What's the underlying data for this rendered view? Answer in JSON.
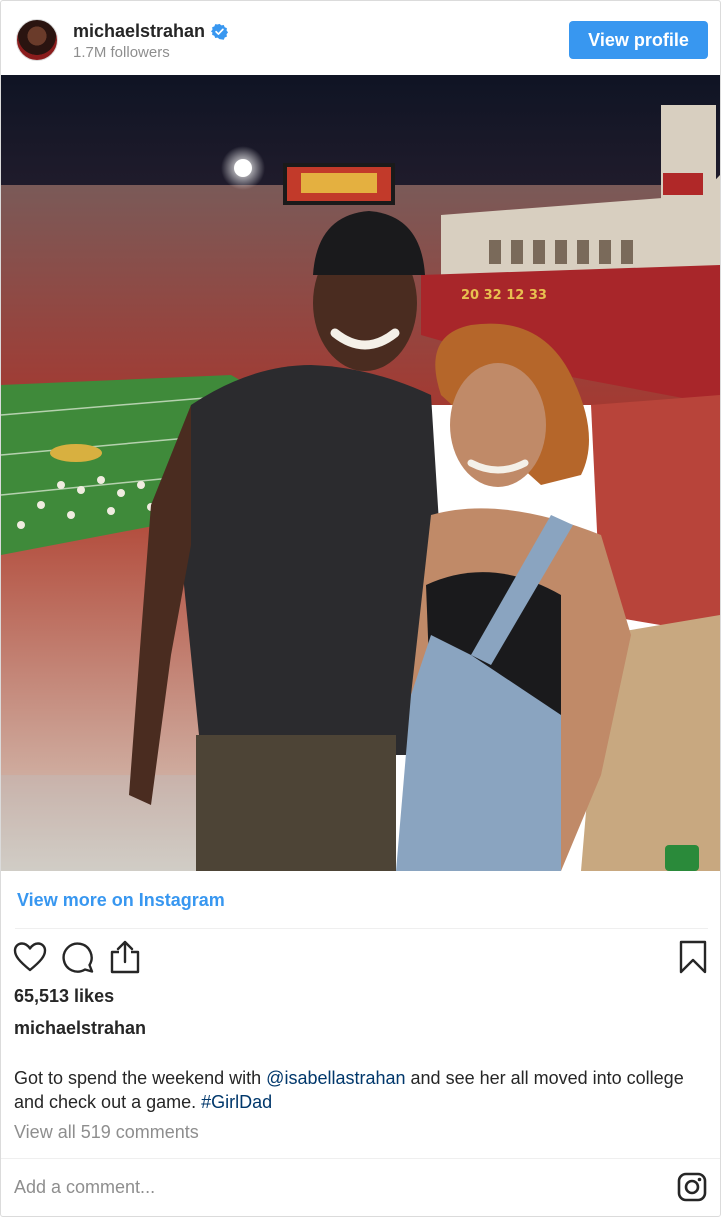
{
  "header": {
    "username": "michaelstrahan",
    "followers": "1.7M followers",
    "view_profile_label": "View profile"
  },
  "view_more_label": "View more on Instagram",
  "likes": "65,513 likes",
  "caption": {
    "username": "michaelstrahan",
    "text_before": "Got to spend the weekend with ",
    "mention": "@isabellastrahan",
    "text_middle": " and see her all moved into college and check out a game. ",
    "hashtag": "#GirlDad"
  },
  "comments_link": "View all 519 comments",
  "add_comment_placeholder": "Add a comment...",
  "photo": {
    "scoreboard_text": "20   32   12   33"
  },
  "colors": {
    "accent": "#3897f0",
    "link": "#00376b",
    "muted": "#8e8e8e"
  },
  "icons": [
    "verified-badge-icon",
    "heart-icon",
    "comment-icon",
    "share-icon",
    "bookmark-icon",
    "instagram-logo-icon"
  ]
}
